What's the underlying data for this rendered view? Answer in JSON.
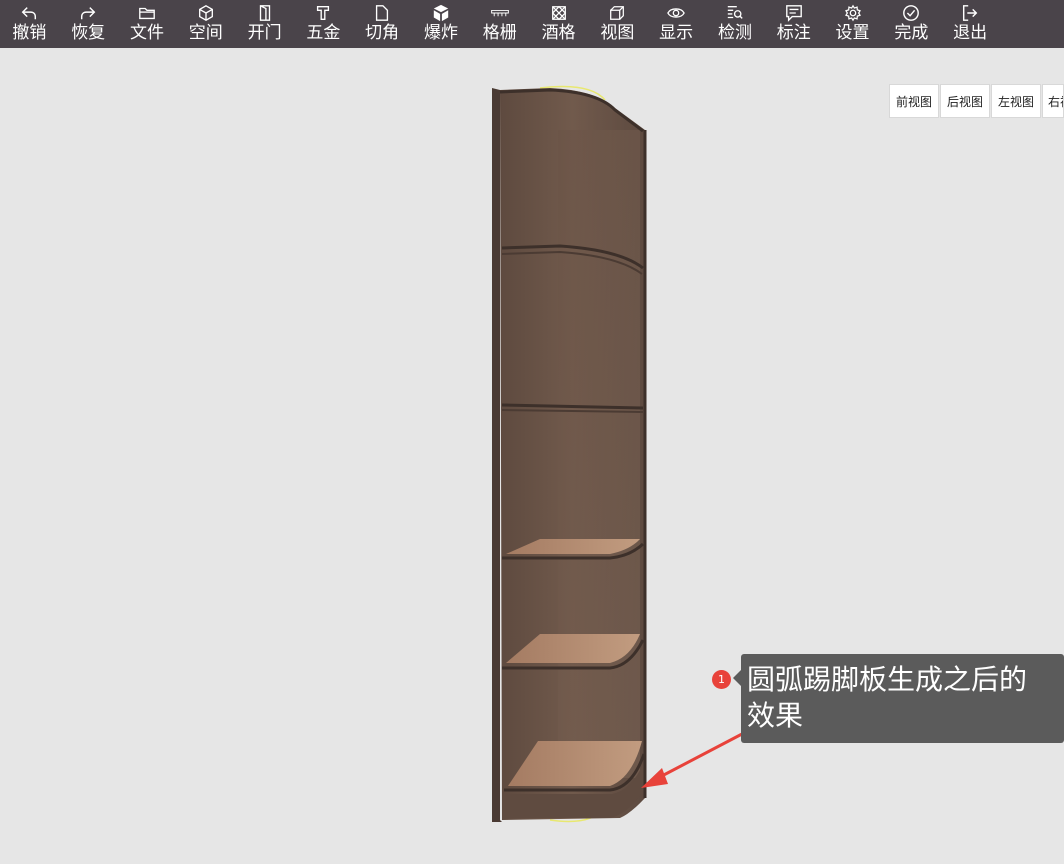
{
  "toolbar": {
    "items": [
      {
        "label": "撤销",
        "icon": "undo-icon"
      },
      {
        "label": "恢复",
        "icon": "redo-icon"
      },
      {
        "label": "文件",
        "icon": "folder-icon"
      },
      {
        "label": "空间",
        "icon": "cube-icon"
      },
      {
        "label": "开门",
        "icon": "door-icon"
      },
      {
        "label": "五金",
        "icon": "hardware-icon"
      },
      {
        "label": "切角",
        "icon": "corner-cut-icon"
      },
      {
        "label": "爆炸",
        "icon": "explode-icon"
      },
      {
        "label": "格栅",
        "icon": "grille-icon"
      },
      {
        "label": "酒格",
        "icon": "wine-rack-icon"
      },
      {
        "label": "视图",
        "icon": "view-cube-icon"
      },
      {
        "label": "显示",
        "icon": "eye-icon"
      },
      {
        "label": "检测",
        "icon": "inspect-icon"
      },
      {
        "label": "标注",
        "icon": "annotation-icon"
      },
      {
        "label": "设置",
        "icon": "gear-icon"
      },
      {
        "label": "完成",
        "icon": "check-circle-icon"
      },
      {
        "label": "退出",
        "icon": "exit-icon"
      }
    ]
  },
  "view_buttons": [
    "前视图",
    "后视图",
    "左视图",
    "右视"
  ],
  "callout": {
    "number": "1",
    "line1": "圆弧踢脚板生成之后的",
    "line2": "效果"
  },
  "colors": {
    "toolbar_bg": "#4a444a",
    "canvas_bg": "#e6e6e6",
    "wood_dark": "#6b5548",
    "shelf_light": "#b58a6e",
    "callout_bg": "#5b5b5b",
    "badge_red": "#e8423a",
    "arrow_red": "#e8423a"
  }
}
